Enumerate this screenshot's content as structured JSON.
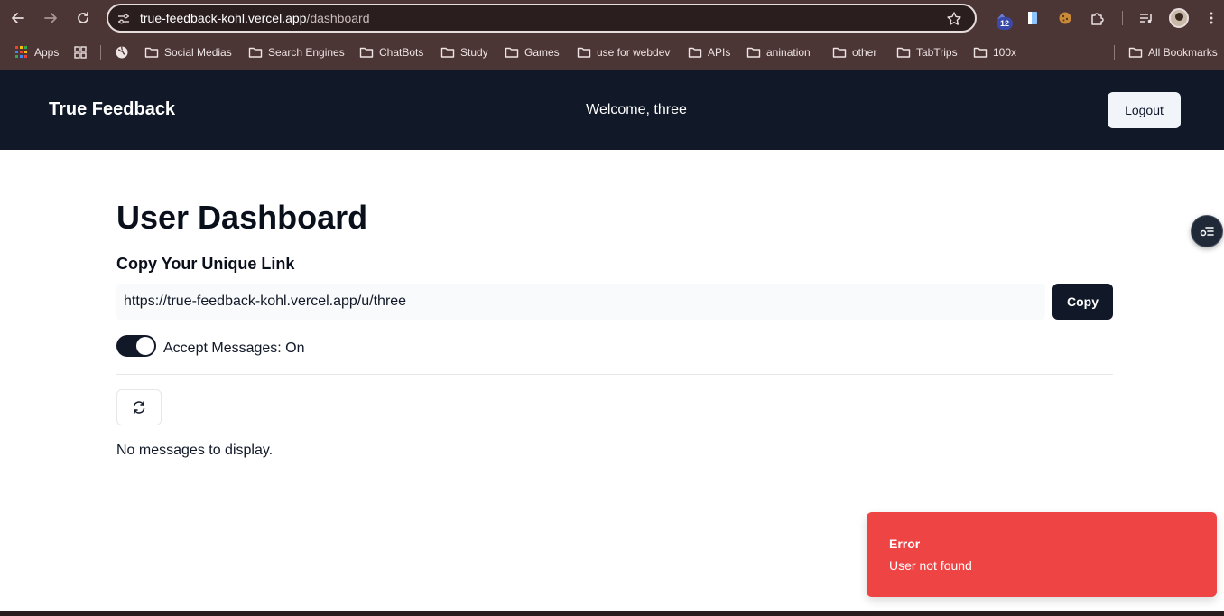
{
  "browser": {
    "url_host": "true-feedback-kohl.vercel.app",
    "url_path": "/dashboard",
    "extension_badge": "12",
    "bookmarks": [
      {
        "label": "Apps",
        "icon": "apps-grid-icon"
      },
      {
        "label": "",
        "icon": "grid-icon"
      },
      {
        "label": "",
        "icon": "globe-icon"
      },
      {
        "label": "Social Medias",
        "icon": "folder-icon"
      },
      {
        "label": "Search Engines",
        "icon": "folder-icon"
      },
      {
        "label": "ChatBots",
        "icon": "folder-icon"
      },
      {
        "label": "Study",
        "icon": "folder-icon"
      },
      {
        "label": "Games",
        "icon": "folder-icon"
      },
      {
        "label": "use for webdev",
        "icon": "folder-icon"
      },
      {
        "label": "APIs",
        "icon": "folder-icon"
      },
      {
        "label": "anination",
        "icon": "folder-icon"
      },
      {
        "label": "other",
        "icon": "folder-icon"
      },
      {
        "label": "TabTrips",
        "icon": "folder-icon"
      },
      {
        "label": "100x",
        "icon": "folder-icon"
      }
    ],
    "all_bookmarks": "All Bookmarks"
  },
  "header": {
    "brand": "True Feedback",
    "welcome": "Welcome, three",
    "logout_label": "Logout"
  },
  "main": {
    "title": "User Dashboard",
    "link_section_title": "Copy Your Unique Link",
    "unique_link": "https://true-feedback-kohl.vercel.app/u/three",
    "copy_label": "Copy",
    "accept_messages_label": "Accept Messages: On",
    "accept_messages_on": true,
    "empty_message": "No messages to display."
  },
  "toast": {
    "title": "Error",
    "description": "User not found"
  },
  "colors": {
    "header_bg": "#111827",
    "toast_bg": "#ef4444",
    "chrome_bg": "#4c3535"
  }
}
